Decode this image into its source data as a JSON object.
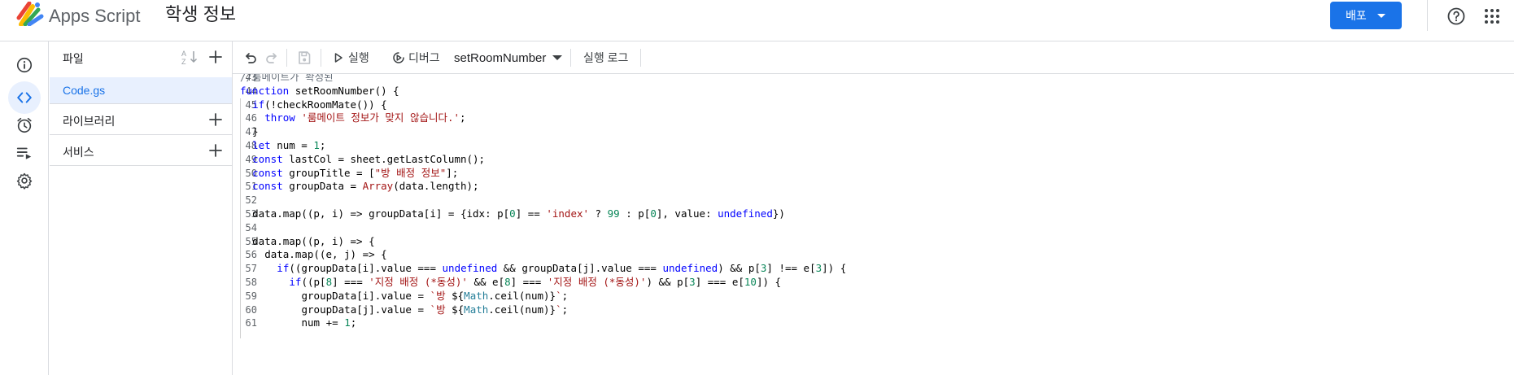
{
  "header": {
    "app_name": "Apps Script",
    "project_title": "학생 정보",
    "deploy_label": "배포"
  },
  "files_panel": {
    "files_label": "파일",
    "active_file": "Code.gs",
    "libraries_label": "라이브러리",
    "services_label": "서비스"
  },
  "toolbar": {
    "run_label": "실행",
    "debug_label": "디버그",
    "function_name": "setRoomNumber",
    "log_label": "실행 로그"
  },
  "editor": {
    "lines": [
      {
        "n": "43",
        "indent": 0,
        "tokens": [
          [
            "cmt",
            "//룸메이트가 확정된"
          ]
        ]
      },
      {
        "n": "44",
        "indent": 0,
        "tokens": [
          [
            "kw",
            "function"
          ],
          [
            "txt",
            " setRoomNumber() {"
          ]
        ]
      },
      {
        "n": "45",
        "indent": 1,
        "tokens": [
          [
            "kw",
            "if"
          ],
          [
            "txt",
            "(!checkRoomMate()) {"
          ]
        ]
      },
      {
        "n": "46",
        "indent": 2,
        "tokens": [
          [
            "kw",
            "throw"
          ],
          [
            "txt",
            " "
          ],
          [
            "str",
            "'룸메이트 정보가 맞지 않습니다.'"
          ],
          [
            "txt",
            ";"
          ]
        ]
      },
      {
        "n": "47",
        "indent": 1,
        "tokens": [
          [
            "txt",
            "}"
          ]
        ]
      },
      {
        "n": "48",
        "indent": 1,
        "tokens": [
          [
            "kw",
            "let"
          ],
          [
            "txt",
            " num = "
          ],
          [
            "num",
            "1"
          ],
          [
            "txt",
            ";"
          ]
        ]
      },
      {
        "n": "49",
        "indent": 1,
        "tokens": [
          [
            "kw",
            "const"
          ],
          [
            "txt",
            " lastCol = sheet.getLastColumn();"
          ]
        ]
      },
      {
        "n": "50",
        "indent": 1,
        "tokens": [
          [
            "kw",
            "const"
          ],
          [
            "txt",
            " groupTitle = ["
          ],
          [
            "str",
            "\"방 배정 정보\""
          ],
          [
            "txt",
            "];"
          ]
        ]
      },
      {
        "n": "51",
        "indent": 1,
        "tokens": [
          [
            "kw",
            "const"
          ],
          [
            "txt",
            " groupData = "
          ],
          [
            "str",
            "Array"
          ],
          [
            "txt",
            "(data.length);"
          ]
        ]
      },
      {
        "n": "52",
        "indent": 0,
        "tokens": []
      },
      {
        "n": "53",
        "indent": 1,
        "tokens": [
          [
            "txt",
            "data.map((p, i) => groupData[i] = {idx: p["
          ],
          [
            "num",
            "0"
          ],
          [
            "txt",
            "] == "
          ],
          [
            "str",
            "'index'"
          ],
          [
            "txt",
            " ? "
          ],
          [
            "num",
            "99"
          ],
          [
            "txt",
            " : p["
          ],
          [
            "num",
            "0"
          ],
          [
            "txt",
            "], value: "
          ],
          [
            "kw",
            "undefined"
          ],
          [
            "txt",
            "})"
          ]
        ]
      },
      {
        "n": "54",
        "indent": 0,
        "tokens": []
      },
      {
        "n": "55",
        "indent": 1,
        "tokens": [
          [
            "txt",
            "data.map((p, i) => {"
          ]
        ]
      },
      {
        "n": "56",
        "indent": 2,
        "tokens": [
          [
            "txt",
            "data.map((e, j) => {"
          ]
        ]
      },
      {
        "n": "57",
        "indent": 3,
        "tokens": [
          [
            "kw",
            "if"
          ],
          [
            "txt",
            "((groupData[i].value === "
          ],
          [
            "kw",
            "undefined"
          ],
          [
            "txt",
            " && groupData[j].value === "
          ],
          [
            "kw",
            "undefined"
          ],
          [
            "txt",
            ") && p["
          ],
          [
            "num",
            "3"
          ],
          [
            "txt",
            "] !== e["
          ],
          [
            "num",
            "3"
          ],
          [
            "txt",
            "]) {"
          ]
        ]
      },
      {
        "n": "58",
        "indent": 4,
        "tokens": [
          [
            "kw",
            "if"
          ],
          [
            "txt",
            "((p["
          ],
          [
            "num",
            "8"
          ],
          [
            "txt",
            "] === "
          ],
          [
            "str",
            "'지정 배정 (*동성)'"
          ],
          [
            "txt",
            " && e["
          ],
          [
            "num",
            "8"
          ],
          [
            "txt",
            "] === "
          ],
          [
            "str",
            "'지정 배정 (*동성)'"
          ],
          [
            "txt",
            ") && p["
          ],
          [
            "num",
            "3"
          ],
          [
            "txt",
            "] === e["
          ],
          [
            "num",
            "10"
          ],
          [
            "txt",
            "]) {"
          ]
        ]
      },
      {
        "n": "59",
        "indent": 5,
        "tokens": [
          [
            "txt",
            "groupData[i].value = "
          ],
          [
            "str",
            "`방 "
          ],
          [
            "txt",
            "${"
          ],
          [
            "obj",
            "Math"
          ],
          [
            "txt",
            ".ceil(num)}"
          ],
          [
            "str",
            "`"
          ],
          [
            "txt",
            ";"
          ]
        ]
      },
      {
        "n": "60",
        "indent": 5,
        "tokens": [
          [
            "txt",
            "groupData[j].value = "
          ],
          [
            "str",
            "`방 "
          ],
          [
            "txt",
            "${"
          ],
          [
            "obj",
            "Math"
          ],
          [
            "txt",
            ".ceil(num)}"
          ],
          [
            "str",
            "`"
          ],
          [
            "txt",
            ";"
          ]
        ]
      },
      {
        "n": "61",
        "indent": 5,
        "tokens": [
          [
            "txt",
            "num += "
          ],
          [
            "num",
            "1"
          ],
          [
            "txt",
            ";"
          ]
        ]
      }
    ]
  }
}
